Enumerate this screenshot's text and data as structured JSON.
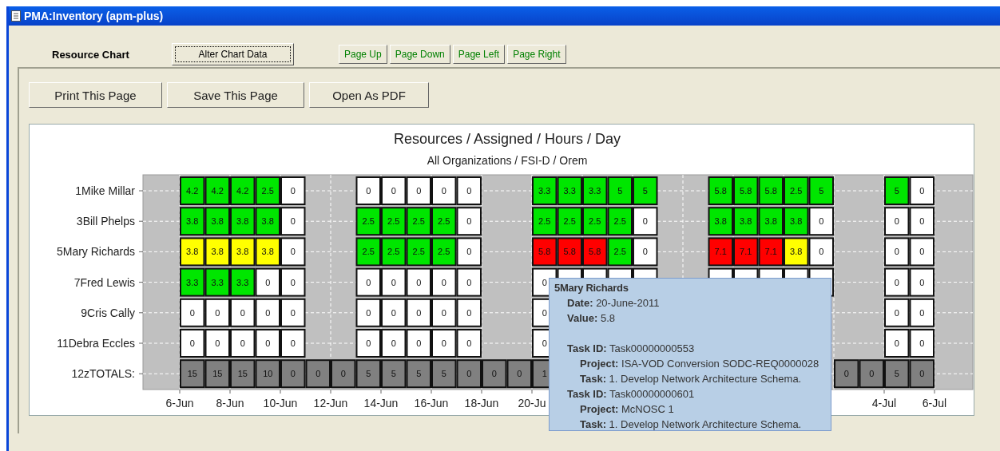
{
  "window": {
    "title": "PMA:Inventory (apm-plus)"
  },
  "toolbar": {
    "label": "Resource Chart",
    "alter_button": "Alter Chart Data",
    "page_buttons": [
      "Page Up",
      "Page Down",
      "Page Left",
      "Page Right"
    ]
  },
  "actions": [
    "Print This Page",
    "Save This Page",
    "Open As PDF"
  ],
  "chart": {
    "title": "Resources / Assigned / Hours / Day",
    "subtitle": "All Organizations / FSI-D / Orem",
    "x_tick_labels_start": [
      "6-Jun",
      "8-Jun",
      "10-Jun",
      "12-Jun",
      "14-Jun",
      "16-Jun",
      "18-Jun",
      "20-Ju"
    ],
    "x_tick_labels_end": [
      "4-Jul",
      "6-Jul"
    ],
    "rows": [
      {
        "label": "1Mike Millar",
        "cells": [
          {
            "value": "4.2",
            "color": "#00e600"
          },
          {
            "value": "4.2",
            "color": "#00e600"
          },
          {
            "value": "4.2",
            "color": "#00e600"
          },
          {
            "value": "2.5",
            "color": "#00e600"
          },
          {
            "value": "0",
            "color": "#ffffff"
          },
          null,
          null,
          {
            "value": "0",
            "color": "#ffffff"
          },
          {
            "value": "0",
            "color": "#ffffff"
          },
          {
            "value": "0",
            "color": "#ffffff"
          },
          {
            "value": "0",
            "color": "#ffffff"
          },
          {
            "value": "0",
            "color": "#ffffff"
          },
          null,
          null,
          {
            "value": "3.3",
            "color": "#00e600"
          },
          {
            "value": "3.3",
            "color": "#00e600"
          },
          {
            "value": "3.3",
            "color": "#00e600"
          },
          {
            "value": "5",
            "color": "#00e600"
          },
          {
            "value": "5",
            "color": "#00e600"
          },
          null,
          null,
          {
            "value": "5.8",
            "color": "#00e600"
          },
          {
            "value": "5.8",
            "color": "#00e600"
          },
          {
            "value": "5.8",
            "color": "#00e600"
          },
          {
            "value": "2.5",
            "color": "#00e600"
          },
          {
            "value": "5",
            "color": "#00e600"
          },
          null,
          null,
          {
            "value": "5",
            "color": "#00e600"
          },
          {
            "value": "0",
            "color": "#ffffff"
          }
        ]
      },
      {
        "label": "3Bill Phelps",
        "cells": [
          {
            "value": "3.8",
            "color": "#00e600"
          },
          {
            "value": "3.8",
            "color": "#00e600"
          },
          {
            "value": "3.8",
            "color": "#00e600"
          },
          {
            "value": "3.8",
            "color": "#00e600"
          },
          {
            "value": "0",
            "color": "#ffffff"
          },
          null,
          null,
          {
            "value": "2.5",
            "color": "#00e600"
          },
          {
            "value": "2.5",
            "color": "#00e600"
          },
          {
            "value": "2.5",
            "color": "#00e600"
          },
          {
            "value": "2.5",
            "color": "#00e600"
          },
          {
            "value": "0",
            "color": "#ffffff"
          },
          null,
          null,
          {
            "value": "2.5",
            "color": "#00e600"
          },
          {
            "value": "2.5",
            "color": "#00e600"
          },
          {
            "value": "2.5",
            "color": "#00e600"
          },
          {
            "value": "2.5",
            "color": "#00e600"
          },
          {
            "value": "0",
            "color": "#ffffff"
          },
          null,
          null,
          {
            "value": "3.8",
            "color": "#00e600"
          },
          {
            "value": "3.8",
            "color": "#00e600"
          },
          {
            "value": "3.8",
            "color": "#00e600"
          },
          {
            "value": "3.8",
            "color": "#00e600"
          },
          {
            "value": "0",
            "color": "#ffffff"
          },
          null,
          null,
          {
            "value": "0",
            "color": "#ffffff"
          },
          {
            "value": "0",
            "color": "#ffffff"
          }
        ]
      },
      {
        "label": "5Mary Richards",
        "cells": [
          {
            "value": "3.8",
            "color": "#ffff00"
          },
          {
            "value": "3.8",
            "color": "#ffff00"
          },
          {
            "value": "3.8",
            "color": "#ffff00"
          },
          {
            "value": "3.8",
            "color": "#ffff00"
          },
          {
            "value": "0",
            "color": "#ffffff"
          },
          null,
          null,
          {
            "value": "2.5",
            "color": "#00e600"
          },
          {
            "value": "2.5",
            "color": "#00e600"
          },
          {
            "value": "2.5",
            "color": "#00e600"
          },
          {
            "value": "2.5",
            "color": "#00e600"
          },
          {
            "value": "0",
            "color": "#ffffff"
          },
          null,
          null,
          {
            "value": "5.8",
            "color": "#ff0000"
          },
          {
            "value": "5.8",
            "color": "#ff0000"
          },
          {
            "value": "5.8",
            "color": "#ff0000"
          },
          {
            "value": "2.5",
            "color": "#00e600"
          },
          {
            "value": "0",
            "color": "#ffffff"
          },
          null,
          null,
          {
            "value": "7.1",
            "color": "#ff0000"
          },
          {
            "value": "7.1",
            "color": "#ff0000"
          },
          {
            "value": "7.1",
            "color": "#ff0000"
          },
          {
            "value": "3.8",
            "color": "#ffff00"
          },
          {
            "value": "0",
            "color": "#ffffff"
          },
          null,
          null,
          {
            "value": "0",
            "color": "#ffffff"
          },
          {
            "value": "0",
            "color": "#ffffff"
          }
        ]
      },
      {
        "label": "7Fred Lewis",
        "cells": [
          {
            "value": "3.3",
            "color": "#00e600"
          },
          {
            "value": "3.3",
            "color": "#00e600"
          },
          {
            "value": "3.3",
            "color": "#00e600"
          },
          {
            "value": "0",
            "color": "#ffffff"
          },
          {
            "value": "0",
            "color": "#ffffff"
          },
          null,
          null,
          {
            "value": "0",
            "color": "#ffffff"
          },
          {
            "value": "0",
            "color": "#ffffff"
          },
          {
            "value": "0",
            "color": "#ffffff"
          },
          {
            "value": "0",
            "color": "#ffffff"
          },
          {
            "value": "0",
            "color": "#ffffff"
          },
          null,
          null,
          {
            "value": "0",
            "color": "#ffffff"
          },
          {
            "color": "#ffffff"
          },
          {
            "color": "#ffffff"
          },
          {
            "color": "#ffffff"
          },
          {
            "color": "#ffffff"
          },
          null,
          null,
          {
            "color": "#ffffff"
          },
          {
            "color": "#ffffff"
          },
          {
            "color": "#ffffff"
          },
          {
            "color": "#ffffff"
          },
          {
            "color": "#ffffff"
          },
          null,
          null,
          {
            "value": "0",
            "color": "#ffffff"
          },
          {
            "value": "0",
            "color": "#ffffff"
          }
        ]
      },
      {
        "label": "9Cris Cally",
        "cells": [
          {
            "value": "0",
            "color": "#ffffff"
          },
          {
            "value": "0",
            "color": "#ffffff"
          },
          {
            "value": "0",
            "color": "#ffffff"
          },
          {
            "value": "0",
            "color": "#ffffff"
          },
          {
            "value": "0",
            "color": "#ffffff"
          },
          null,
          null,
          {
            "value": "0",
            "color": "#ffffff"
          },
          {
            "value": "0",
            "color": "#ffffff"
          },
          {
            "value": "0",
            "color": "#ffffff"
          },
          {
            "value": "0",
            "color": "#ffffff"
          },
          {
            "value": "0",
            "color": "#ffffff"
          },
          null,
          null,
          {
            "value": "0",
            "color": "#ffffff"
          },
          null,
          null,
          null,
          null,
          null,
          null,
          null,
          null,
          null,
          null,
          null,
          null,
          null,
          {
            "value": "0",
            "color": "#ffffff"
          },
          {
            "value": "0",
            "color": "#ffffff"
          }
        ]
      },
      {
        "label": "11Debra Eccles",
        "cells": [
          {
            "value": "0",
            "color": "#ffffff"
          },
          {
            "value": "0",
            "color": "#ffffff"
          },
          {
            "value": "0",
            "color": "#ffffff"
          },
          {
            "value": "0",
            "color": "#ffffff"
          },
          {
            "value": "0",
            "color": "#ffffff"
          },
          null,
          null,
          {
            "value": "0",
            "color": "#ffffff"
          },
          {
            "value": "0",
            "color": "#ffffff"
          },
          {
            "value": "0",
            "color": "#ffffff"
          },
          {
            "value": "0",
            "color": "#ffffff"
          },
          {
            "value": "0",
            "color": "#ffffff"
          },
          null,
          null,
          {
            "value": "0",
            "color": "#ffffff"
          },
          null,
          null,
          null,
          null,
          null,
          null,
          null,
          null,
          null,
          null,
          null,
          null,
          null,
          {
            "value": "0",
            "color": "#ffffff"
          },
          {
            "value": "0",
            "color": "#ffffff"
          }
        ]
      },
      {
        "label": "12zTOTALS:",
        "cells": [
          {
            "value": "15",
            "color": "#808080"
          },
          {
            "value": "15",
            "color": "#808080"
          },
          {
            "value": "15",
            "color": "#808080"
          },
          {
            "value": "10",
            "color": "#808080"
          },
          {
            "value": "0",
            "color": "#808080"
          },
          {
            "value": "0",
            "color": "#808080"
          },
          {
            "value": "0",
            "color": "#808080"
          },
          {
            "value": "5",
            "color": "#808080"
          },
          {
            "value": "5",
            "color": "#808080"
          },
          {
            "value": "5",
            "color": "#808080"
          },
          {
            "value": "5",
            "color": "#808080"
          },
          {
            "value": "0",
            "color": "#808080"
          },
          {
            "value": "0",
            "color": "#808080"
          },
          {
            "value": "0",
            "color": "#808080"
          },
          {
            "value": "1",
            "color": "#808080"
          },
          null,
          null,
          null,
          null,
          null,
          null,
          null,
          null,
          null,
          null,
          null,
          {
            "value": "0",
            "color": "#808080"
          },
          {
            "value": "0",
            "color": "#808080"
          },
          {
            "value": "5",
            "color": "#808080"
          },
          {
            "value": "0",
            "color": "#808080"
          }
        ]
      }
    ]
  },
  "tooltip": {
    "title": "5Mary Richards",
    "fields": [
      "**Date:** 20-June-2011",
      "**Value:** 5.8"
    ],
    "tasks": [
      {
        "text": "**Task ID:** Task00000000553",
        "children": [
          "**Project:** ISA-VOD Conversion SODC-REQ0000028",
          "**Task:** 1. Develop Network Architecture Schema."
        ]
      },
      {
        "text": "**Task ID:** Task00000000601",
        "children": [
          "**Project:** McNOSC 1",
          "**Task:** 1. Develop Network Architecture Schema."
        ]
      }
    ]
  }
}
